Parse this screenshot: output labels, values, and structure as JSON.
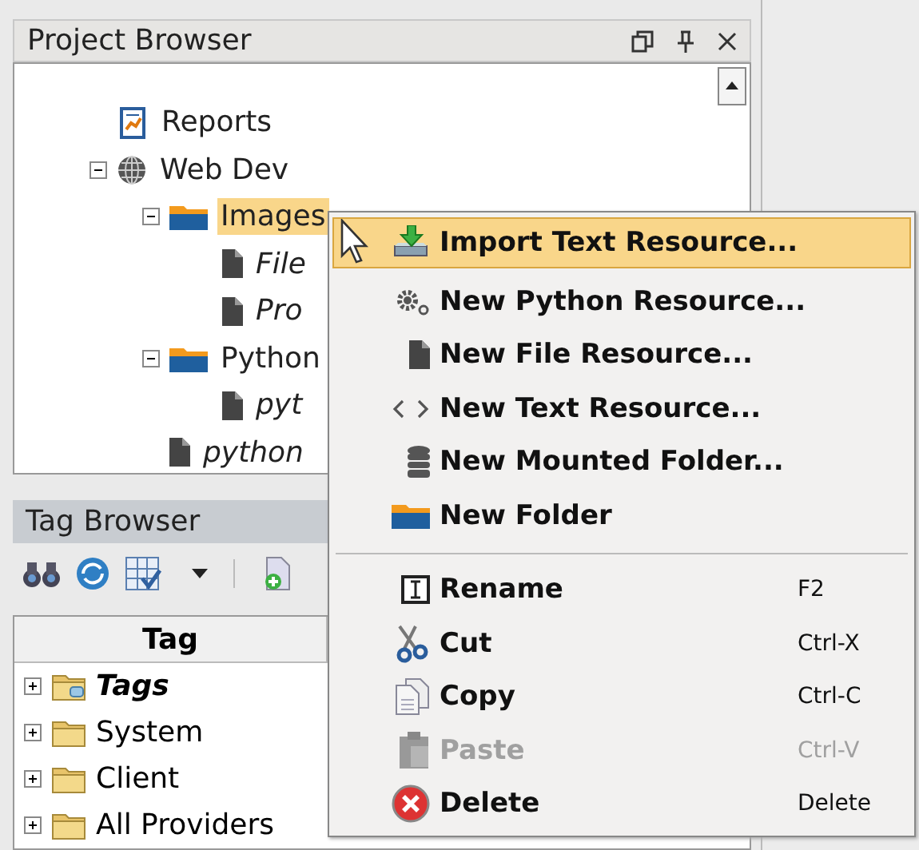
{
  "project_browser": {
    "title": "Project Browser",
    "tree": [
      {
        "label": "Reports",
        "kind": "report",
        "selected": false
      },
      {
        "label": "Web Dev",
        "kind": "web",
        "expanded": true,
        "selected": false,
        "children": [
          {
            "label": "Images",
            "kind": "folder",
            "expanded": true,
            "selected": true,
            "children": [
              {
                "label": "File",
                "kind": "file",
                "selected": false
              },
              {
                "label": "Pro",
                "kind": "file",
                "selected": false
              }
            ]
          },
          {
            "label": "Python",
            "kind": "folder",
            "expanded": true,
            "selected": false,
            "children": [
              {
                "label": "pyt",
                "kind": "file",
                "selected": false
              }
            ]
          },
          {
            "label": "python",
            "kind": "file",
            "selected": false
          }
        ]
      }
    ]
  },
  "tag_browser": {
    "title": "Tag Browser",
    "column_header": "Tag",
    "tree": [
      {
        "label": "Tags",
        "kind": "root",
        "expanded": false
      },
      {
        "label": "System",
        "kind": "folder",
        "expanded": false
      },
      {
        "label": "Client",
        "kind": "folder",
        "expanded": false
      },
      {
        "label": "All Providers",
        "kind": "folder",
        "expanded": false
      }
    ]
  },
  "context_menu": [
    {
      "kind": "item",
      "label": "Import Text Resource...",
      "selected": true,
      "disabled": false
    },
    {
      "kind": "item",
      "label": "New Python Resource...",
      "selected": false,
      "disabled": false
    },
    {
      "kind": "item",
      "label": "New File Resource...",
      "selected": false,
      "disabled": false
    },
    {
      "kind": "item",
      "label": "New Text Resource...",
      "selected": false,
      "disabled": false
    },
    {
      "kind": "item",
      "label": "New Mounted Folder...",
      "selected": false,
      "disabled": false
    },
    {
      "kind": "item",
      "label": "New Folder",
      "selected": false,
      "disabled": false
    },
    {
      "kind": "separator"
    },
    {
      "kind": "item",
      "label": "Rename",
      "shortcut": "F2",
      "selected": false,
      "disabled": false
    },
    {
      "kind": "item",
      "label": "Cut",
      "shortcut": "Ctrl-X",
      "selected": false,
      "disabled": false
    },
    {
      "kind": "item",
      "label": "Copy",
      "shortcut": "Ctrl-C",
      "selected": false,
      "disabled": false
    },
    {
      "kind": "item",
      "label": "Paste",
      "shortcut": "Ctrl-V",
      "selected": false,
      "disabled": true
    },
    {
      "kind": "item",
      "label": "Delete",
      "shortcut": "Delete",
      "selected": false,
      "disabled": false
    }
  ]
}
